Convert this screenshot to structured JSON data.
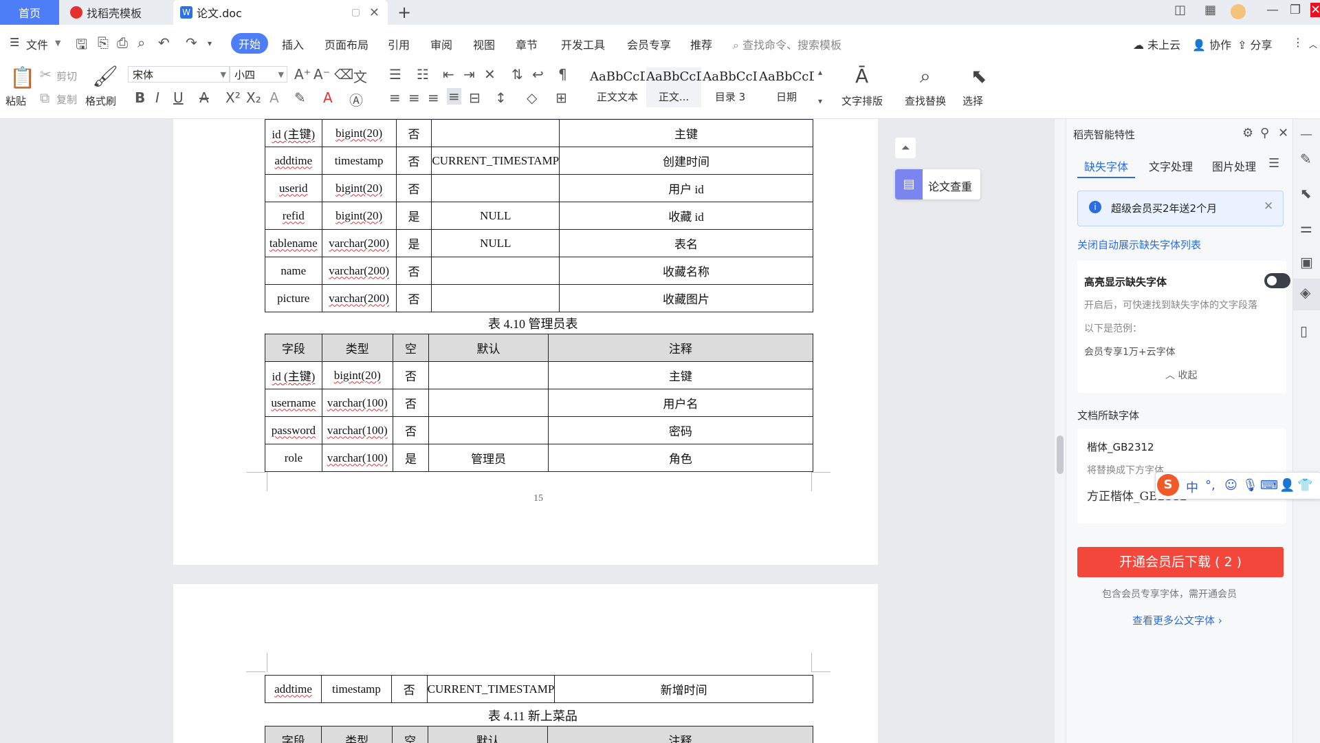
{
  "tabs": {
    "home": "首页",
    "template": "找稻壳模板",
    "doc": "论文.doc",
    "new_tab": "+"
  },
  "menu": {
    "file": "文件",
    "items": [
      "开始",
      "插入",
      "页面布局",
      "引用",
      "审阅",
      "视图",
      "章节",
      "开发工具",
      "会员专享",
      "推荐"
    ],
    "search_placeholder": "查找命令、搜索模板",
    "cloud": "未上云",
    "collab": "协作",
    "share": "分享"
  },
  "ribbon": {
    "paste": "粘贴",
    "cut": "剪切",
    "copy": "复制",
    "format_painter": "格式刷",
    "font_name": "宋体",
    "font_size": "小四",
    "styles": [
      {
        "preview": "AaBbCcDd",
        "label": "正文文本"
      },
      {
        "preview": "AaBbCcDd",
        "label": "正文..."
      },
      {
        "preview": "AaBbCcI",
        "label": "目录 3"
      },
      {
        "preview": "AaBbCcDd",
        "label": "日期"
      }
    ],
    "text_layout": "文字排版",
    "find_replace": "查找替换",
    "select": "选择"
  },
  "doc": {
    "table_a_rows": [
      [
        "id (主键)",
        "bigint(20)",
        "否",
        "",
        "主键"
      ],
      [
        "addtime",
        "timestamp",
        "否",
        "CURRENT_TIMESTAMP",
        "创建时间"
      ],
      [
        "userid",
        "bigint(20)",
        "否",
        "",
        "用户 id"
      ],
      [
        "refid",
        "bigint(20)",
        "是",
        "NULL",
        "收藏 id"
      ],
      [
        "tablename",
        "varchar(200)",
        "是",
        "NULL",
        "表名"
      ],
      [
        "name",
        "varchar(200)",
        "否",
        "",
        "收藏名称"
      ],
      [
        "picture",
        "varchar(200)",
        "否",
        "",
        "收藏图片"
      ]
    ],
    "caption_410": "表 4.10  管理员表",
    "table_b_header": [
      "字段",
      "类型",
      "空",
      "默认",
      "注释"
    ],
    "table_b_rows": [
      [
        "id (主键)",
        "bigint(20)",
        "否",
        "",
        "主键"
      ],
      [
        "username",
        "varchar(100)",
        "否",
        "",
        "用户名"
      ],
      [
        "password",
        "varchar(100)",
        "否",
        "",
        "密码"
      ],
      [
        "role",
        "varchar(100)",
        "是",
        "管理员",
        "角色"
      ]
    ],
    "page_number": "15",
    "table_c_rows": [
      [
        "addtime",
        "timestamp",
        "否",
        "CURRENT_TIMESTAMP",
        "新增时间"
      ]
    ],
    "caption_411": "表 4.11  新上菜品",
    "table_d_header": [
      "字段",
      "类型",
      "空",
      "默认",
      "注释"
    ]
  },
  "float": {
    "check_paper": "论文查重"
  },
  "panel": {
    "title": "稻壳智能特性",
    "tabs": [
      "缺失字体",
      "文字处理",
      "图片处理"
    ],
    "promo": "超级会员买2年送2个月",
    "close_auto": "关闭自动展示缺失字体列表",
    "highlight_title": "高亮显示缺失字体",
    "highlight_desc": "开启后，可快速找到缺失字体的文字段落",
    "example_label": "以下是范例：",
    "example_value": "会员专享1万+云字体",
    "collapse": "收起",
    "missing_title": "文档所缺字体",
    "missing_font": "楷体_GB2312",
    "replace_hint": "将替换成下方字体",
    "replace_font": "方正楷体_GB2312",
    "download_btn": "开通会员后下载 ( 2 )",
    "note": "包含会员专享字体，需开通会员",
    "more_link": "查看更多公文字体"
  },
  "ime": {
    "mode": "中"
  }
}
